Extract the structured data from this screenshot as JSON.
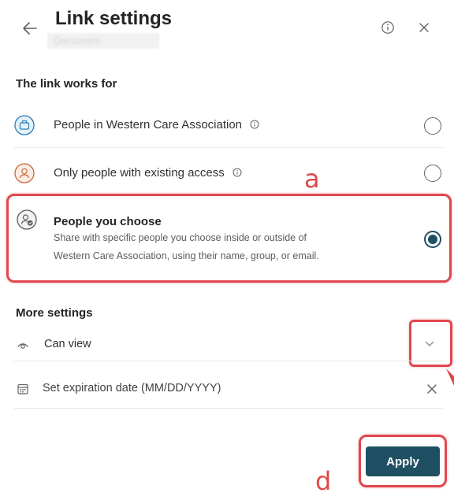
{
  "header": {
    "title": "Link settings",
    "subtitle_redacted": "Document",
    "back_icon": "back-arrow-icon",
    "info_icon": "info-icon",
    "close_icon": "close-icon"
  },
  "link_works_for": {
    "label": "The link works for",
    "options": [
      {
        "label": "People in Western Care Association",
        "icon": "organization-icon",
        "selected": false
      },
      {
        "label": "Only people with existing access",
        "icon": "person-icon",
        "selected": false
      },
      {
        "label": "People you choose",
        "description_line1": "Share with specific people you choose inside or outside of",
        "description_line2": "Western Care Association, using their name, group, or email.",
        "icon": "people-choose-icon",
        "selected": true
      }
    ]
  },
  "more_settings": {
    "label": "More settings",
    "permission": {
      "value": "Can view",
      "icon": "eye-icon"
    },
    "expiration": {
      "placeholder": "Set expiration date (MM/DD/YYYY)",
      "icon": "calendar-icon"
    }
  },
  "actions": {
    "apply_label": "Apply"
  },
  "annotations": {
    "a": "a",
    "d": "d"
  },
  "colors": {
    "accent": "#1f4f63",
    "annotation_red": "#e0474c",
    "text": "#242424"
  }
}
